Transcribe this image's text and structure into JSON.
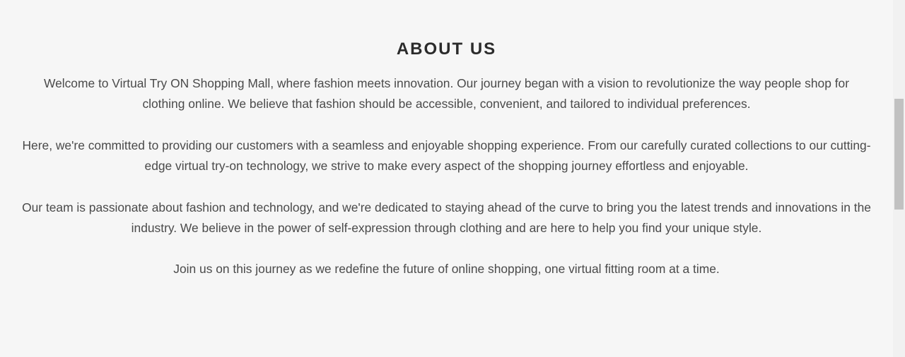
{
  "about": {
    "title": "ABOUT US",
    "paragraphs": [
      "Welcome to Virtual Try ON Shopping Mall, where fashion meets innovation. Our journey began with a vision to revolutionize the way people shop for clothing online. We believe that fashion should be accessible, convenient, and tailored to individual preferences.",
      "Here, we're committed to providing our customers with a seamless and enjoyable shopping experience. From our carefully curated collections to our cutting-edge virtual try-on technology, we strive to make every aspect of the shopping journey effortless and enjoyable.",
      "Our team is passionate about fashion and technology, and we're dedicated to staying ahead of the curve to bring you the latest trends and innovations in the industry. We believe in the power of self-expression through clothing and are here to help you find your unique style.",
      "Join us on this journey as we redefine the future of online shopping, one virtual fitting room at a time."
    ]
  },
  "colors": {
    "background": "#f6f6f6",
    "title": "#2b2b2b",
    "body_text": "#4a4a4a",
    "scrollbar_track": "#f1f1f1",
    "scrollbar_thumb": "#c1c1c1"
  }
}
